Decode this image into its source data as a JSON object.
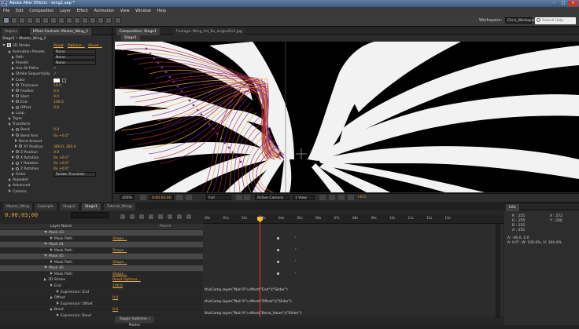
{
  "app": {
    "title": "Adobe After Effects - wing2.aep *",
    "logo": "Ae"
  },
  "window": {
    "minimize": "–",
    "maximize": "□",
    "close": "✕"
  },
  "menu": [
    "File",
    "Edit",
    "Composition",
    "Layer",
    "Effect",
    "Animation",
    "View",
    "Window",
    "Help"
  ],
  "toolbar": {
    "workspace_label": "Workspace:",
    "workspace_value": "Chris_Workspace",
    "search_placeholder": "Search Help"
  },
  "left_panel": {
    "tabs": [
      "Project",
      "Effect Controls: Master_Wing_2"
    ],
    "breadcrumb": "Stage1 • Master_Wing_2",
    "effect": {
      "name": "3D Stroke",
      "reset": "Reset",
      "options": "Options...",
      "about": "About..."
    },
    "props": [
      {
        "n": "Animation Presets",
        "v": "None",
        "t": "sel",
        "ind": 2
      },
      {
        "n": "Path",
        "v": "None",
        "t": "sel",
        "ind": 3
      },
      {
        "n": "Presets",
        "v": "None",
        "t": "sel",
        "ind": 3
      },
      {
        "n": "Use All Paths",
        "v": "✓",
        "t": "w",
        "ind": 3
      },
      {
        "n": "Stroke Sequentially",
        "v": "✓",
        "t": "w",
        "ind": 3
      },
      {
        "n": "Color",
        "v": "",
        "t": "color",
        "ind": 3
      },
      {
        "n": "Thickness",
        "v": "10.0",
        "t": "o",
        "ind": 3
      },
      {
        "n": "Feather",
        "v": "0.0",
        "t": "o",
        "ind": 3
      },
      {
        "n": "Start",
        "v": "0.0",
        "t": "o",
        "ind": 3
      },
      {
        "n": "End",
        "v": "100.0",
        "t": "o",
        "ind": 3
      },
      {
        "n": "Offset",
        "v": "0.0",
        "t": "o",
        "ind": 3
      },
      {
        "n": "Loop",
        "v": "",
        "t": "w",
        "ind": 3
      },
      {
        "n": "Taper",
        "v": "",
        "t": "w",
        "ind": 2
      },
      {
        "n": "Transform",
        "v": "",
        "t": "w",
        "ind": 2
      },
      {
        "n": "Bend",
        "v": "0.0",
        "t": "o",
        "ind": 3
      },
      {
        "n": "Bend Axis",
        "v": "0x +0.0°",
        "t": "o",
        "ind": 3
      },
      {
        "n": "Bend Around",
        "v": "",
        "t": "w",
        "ind": 4
      },
      {
        "n": "XY Position",
        "v": "360.0, 360.0",
        "t": "o",
        "ind": 4
      },
      {
        "n": "Z Position",
        "v": "0.0",
        "t": "o",
        "ind": 3
      },
      {
        "n": "X Rotation",
        "v": "0x +0.0°",
        "t": "o",
        "ind": 3
      },
      {
        "n": "Y Rotation",
        "v": "0x +0.0°",
        "t": "o",
        "ind": 3
      },
      {
        "n": "Z Rotation",
        "v": "0x +0.0°",
        "t": "o",
        "ind": 3
      },
      {
        "n": "Order",
        "v": "Rotate Translate",
        "t": "sel",
        "ind": 3
      },
      {
        "n": "Repeater",
        "v": "",
        "t": "w",
        "ind": 2
      },
      {
        "n": "Advanced",
        "v": "",
        "t": "w",
        "ind": 2
      },
      {
        "n": "Camera",
        "v": "",
        "t": "w",
        "ind": 2
      }
    ]
  },
  "viewer": {
    "tabs": [
      "Composition: Stage1",
      "Footage: Wing_Art_Bv_angled5v1.jpg"
    ],
    "sub_tab": "Stage1",
    "bar": {
      "zoom": "200%",
      "timecode": "0:00:03:00",
      "resolution": "Full",
      "camera": "Active Camera",
      "views": "1 View",
      "exposure": "+0.0"
    }
  },
  "timeline": {
    "tabs": [
      "Master_Wing",
      "Example",
      "Stage2",
      "Stage1",
      "Tutorial_Wings"
    ],
    "timecode": "0;00;03;00",
    "header": "Layer Name",
    "ruler": [
      "00s",
      "01s",
      "02s",
      "03s",
      "04s",
      "05s",
      "06s",
      "07s",
      "08s",
      "09s",
      "10s",
      "11s",
      "12s",
      "13s"
    ],
    "rows": [
      {
        "n": "Mask 43",
        "ind": 1,
        "mask": true,
        "v": ""
      },
      {
        "n": "Mask Path",
        "ind": 2,
        "v": "Shape..."
      },
      {
        "n": "Mask 44",
        "ind": 1,
        "mask": true,
        "v": ""
      },
      {
        "n": "Mask Path",
        "ind": 2,
        "v": "Shape..."
      },
      {
        "n": "Mask 45",
        "ind": 1,
        "mask": true,
        "v": ""
      },
      {
        "n": "Mask Path",
        "ind": 2,
        "v": "Shape..."
      },
      {
        "n": "Mask 46",
        "ind": 1,
        "mask": true,
        "v": ""
      },
      {
        "n": "Mask Path",
        "ind": 2,
        "v": "Shape..."
      },
      {
        "n": "3D Stroke",
        "ind": 1,
        "v": "Reset   Options..."
      },
      {
        "n": "End",
        "ind": 2,
        "v": "100.0"
      },
      {
        "n": "Expression: End",
        "ind": 3,
        "v": ""
      },
      {
        "n": "Offset",
        "ind": 2,
        "v": "0.0"
      },
      {
        "n": "Expression: Offset",
        "ind": 3,
        "v": ""
      },
      {
        "n": "Bend",
        "ind": 2,
        "v": "0.0"
      },
      {
        "n": "Expression: Bend",
        "ind": 3,
        "v": ""
      }
    ],
    "expressions": [
      "thisComp.layer(\"Null 9\").effect(\"End\")(\"Slider\")",
      "thisComp.layer(\"Null 9\").effect(\"Offset\")(\"Slider\")",
      "thisComp.layer(\"Null 9\").effect(\"Bend_Value\")(\"Slider\")"
    ],
    "toggle": "Toggle Switches / Modes"
  },
  "info": {
    "tab": "Info",
    "r": "R : 255",
    "g": "G : 255",
    "b": "B : 255",
    "a": "A : 255",
    "x": "X : 572",
    "y": "Y : 260",
    "line1": "A: -46.0, 0.0",
    "line2": "A: 0.0°, W: 100.0%, H: 100.0%"
  },
  "colors": {
    "accent": "#e9a84a",
    "playhead": "#e33333",
    "strokes": [
      "#c0392b",
      "#8e1d4f",
      "#e6a23c",
      "#7b2d8e"
    ]
  }
}
